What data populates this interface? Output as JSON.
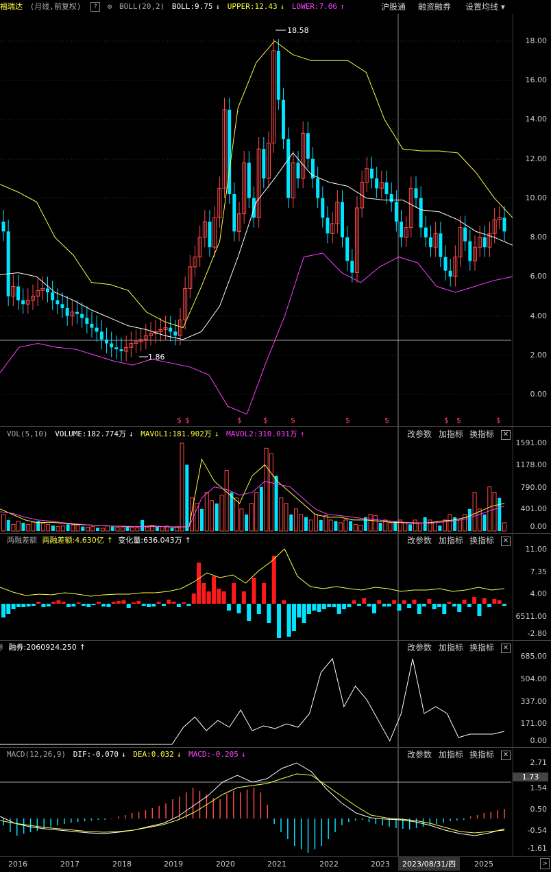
{
  "main": {
    "stock_name": "福瑞达",
    "period": "(月线,前复权)",
    "help": "?",
    "indicator": "BOLL(20,2)",
    "boll": "BOLL:9.75",
    "upper": "UPPER:12.43",
    "lower": "LOWER:7.06",
    "tabs": [
      "沪股通",
      "融资融券",
      "设置均线"
    ],
    "y_labels": [
      "18.00",
      "16.00",
      "14.00",
      "12.00",
      "10.00",
      "8.00",
      "6.00",
      "4.00",
      "2.00",
      "0.00"
    ],
    "high_mark": "18.58",
    "low_mark": "1.86",
    "settings_arrow": "▾"
  },
  "vol": {
    "title": "VOL(5,10)",
    "volume": "VOLUME:182.774万",
    "ma1": "MAVOL1:181.902万",
    "ma2": "MAVOL2:310.031万",
    "y_labels": [
      "1591.00",
      "1178.00",
      "790.00",
      "401.00",
      "0.00"
    ]
  },
  "margin": {
    "title": "两融差额",
    "value": "两融差额:4.630亿",
    "change": "变化量:636.043万",
    "y_labels": [
      "11.00",
      "7.35",
      "4.00",
      "6511.00",
      "-2.80"
    ]
  },
  "short": {
    "title": "融券",
    "value": "融券:2060924.250",
    "y_labels": [
      "685.00",
      "504.00",
      "337.00",
      "171.00",
      "0.00"
    ]
  },
  "macd": {
    "title": "MACD(12,26,9)",
    "dif": "DIF:-0.070",
    "dea": "DEA:0.032",
    "macd": "MACD:-0.205",
    "y_labels": [
      "2.71",
      "1.54",
      "0.50",
      "-0.54",
      "-1.61"
    ],
    "cursor_value": "1.73"
  },
  "panel_tools": {
    "params": "改参数",
    "add": "加指标",
    "swap": "换指标",
    "close": "✕"
  },
  "arrows": {
    "down": "↓",
    "up": "↑"
  },
  "xaxis": {
    "years": [
      "2016",
      "2017",
      "2018",
      "2019",
      "2020",
      "2021",
      "2022",
      "2023",
      "2025"
    ],
    "cursor_date": "2023/08/31/四"
  },
  "colors": {
    "up": "#ff4a4a",
    "down": "#00e5ff",
    "boll": "#ffffff",
    "upper": "#ffff4a",
    "lower": "#ff40ff"
  }
}
